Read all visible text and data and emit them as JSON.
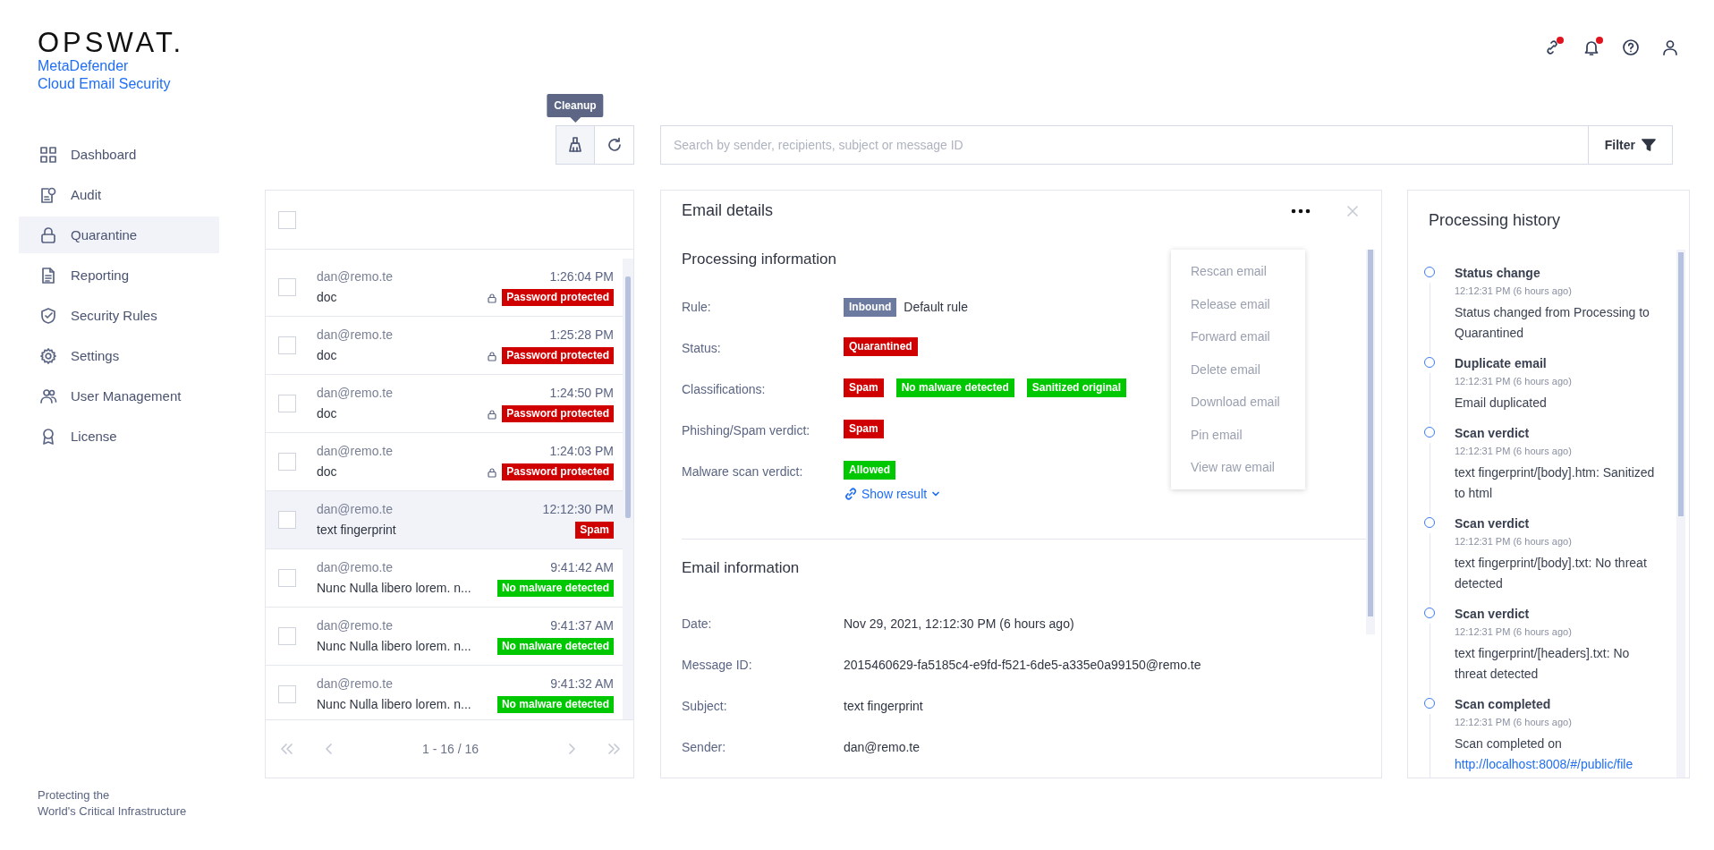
{
  "brand": {
    "logo": "OPSWAT.",
    "product": [
      "MetaDefender",
      "Cloud Email Security"
    ],
    "tagline": [
      "Protecting the",
      "World's Critical Infrastructure"
    ]
  },
  "header_icons": [
    {
      "alert": true
    },
    {
      "alert": true
    },
    {
      "alert": false
    },
    {
      "alert": false
    }
  ],
  "nav": [
    {
      "label": "Dashboard",
      "selected": false
    },
    {
      "label": "Audit",
      "selected": false
    },
    {
      "label": "Quarantine",
      "selected": true
    },
    {
      "label": "Reporting",
      "selected": false
    },
    {
      "label": "Security Rules",
      "selected": false
    },
    {
      "label": "Settings",
      "selected": false
    },
    {
      "label": "User Management",
      "selected": false
    },
    {
      "label": "License",
      "selected": false
    }
  ],
  "toolbar": {
    "tooltip": "Cleanup",
    "search": {
      "placeholder": "Search by sender, recipients, subject or message ID"
    },
    "filter": "Filter"
  },
  "email_list": {
    "select_all": {
      "checked": false
    },
    "rows": [
      {
        "sender": "dan@remo.te",
        "time": "1:26:04 PM",
        "subject": "doc",
        "locked": true,
        "tag": {
          "text": "Password protected",
          "color": "#d10000"
        },
        "selected": false,
        "checked": false
      },
      {
        "sender": "dan@remo.te",
        "time": "1:25:28 PM",
        "subject": "doc",
        "locked": true,
        "tag": {
          "text": "Password protected",
          "color": "#d10000"
        },
        "selected": false,
        "checked": false
      },
      {
        "sender": "dan@remo.te",
        "time": "1:24:50 PM",
        "subject": "doc",
        "locked": true,
        "tag": {
          "text": "Password protected",
          "color": "#d10000"
        },
        "selected": false,
        "checked": false
      },
      {
        "sender": "dan@remo.te",
        "time": "1:24:03 PM",
        "subject": "doc",
        "locked": true,
        "tag": {
          "text": "Password protected",
          "color": "#d10000"
        },
        "selected": false,
        "checked": false
      },
      {
        "sender": "dan@remo.te",
        "time": "12:12:30 PM",
        "subject": "text fingerprint",
        "locked": false,
        "tag": {
          "text": "Spam",
          "color": "#d10000"
        },
        "selected": true,
        "checked": false
      },
      {
        "sender": "dan@remo.te",
        "time": "9:41:42 AM",
        "subject": "Nunc Nulla libero lorem. n...",
        "locked": false,
        "tag": {
          "text": "No malware detected",
          "color": "#00c800"
        },
        "selected": false,
        "checked": false
      },
      {
        "sender": "dan@remo.te",
        "time": "9:41:37 AM",
        "subject": "Nunc Nulla libero lorem. n...",
        "locked": false,
        "tag": {
          "text": "No malware detected",
          "color": "#00c800"
        },
        "selected": false,
        "checked": false
      },
      {
        "sender": "dan@remo.te",
        "time": "9:41:32 AM",
        "subject": "Nunc Nulla libero lorem. n...",
        "locked": false,
        "tag": {
          "text": "No malware detected",
          "color": "#00c800"
        },
        "selected": false,
        "checked": false
      }
    ],
    "pagination": "1 - 16 / 16"
  },
  "details": {
    "title": "Email details",
    "menu": [
      "Rescan email",
      "Release email",
      "Forward email",
      "Delete email",
      "Download email",
      "Pin email",
      "View raw email"
    ],
    "sections": [
      {
        "title": "Processing information",
        "rows": [
          {
            "label": "Rule:",
            "values": [
              {
                "kind": "tag",
                "text": "Inbound",
                "color": "#6b7a9e"
              },
              {
                "kind": "text",
                "text": "Default rule"
              }
            ]
          },
          {
            "label": "Status:",
            "values": [
              {
                "kind": "tag",
                "text": "Quarantined",
                "color": "#d10000"
              }
            ]
          },
          {
            "label": "Classifications:",
            "values": [
              {
                "kind": "tag",
                "text": "Spam",
                "color": "#d10000"
              },
              {
                "kind": "tag",
                "text": "No malware detected",
                "color": "#00c800"
              },
              {
                "kind": "tag",
                "text": "Sanitized original",
                "color": "#00c800"
              }
            ]
          },
          {
            "label": "Phishing/Spam verdict:",
            "values": [
              {
                "kind": "tag",
                "text": "Spam",
                "color": "#d10000"
              }
            ]
          },
          {
            "label": "Malware scan verdict:",
            "values": [
              {
                "kind": "tag",
                "text": "Allowed",
                "color": "#00c800"
              }
            ],
            "link": "Show result"
          }
        ]
      },
      {
        "title": "Email information",
        "rows": [
          {
            "label": "Date:",
            "values": [
              {
                "kind": "text",
                "text": "Nov 29, 2021, 12:12:30 PM (6 hours ago)"
              }
            ]
          },
          {
            "label": "Message ID:",
            "values": [
              {
                "kind": "text",
                "text": "2015460629-fa5185c4-e9fd-f521-6de5-a335e0a99150@remo.te"
              }
            ]
          },
          {
            "label": "Subject:",
            "values": [
              {
                "kind": "text",
                "text": "text fingerprint"
              }
            ]
          },
          {
            "label": "Sender:",
            "values": [
              {
                "kind": "text",
                "text": "dan@remo.te"
              }
            ]
          }
        ]
      }
    ]
  },
  "history": {
    "title": "Processing history",
    "items": [
      {
        "title": "Status change",
        "time": "12:12:31 PM (6 hours ago)",
        "text": "Status changed from Processing to Quarantined"
      },
      {
        "title": "Duplicate email",
        "time": "12:12:31 PM (6 hours ago)",
        "text": "Email duplicated"
      },
      {
        "title": "Scan verdict",
        "time": "12:12:31 PM (6 hours ago)",
        "text": "text fingerprint/[body].htm: Sanitized to html"
      },
      {
        "title": "Scan verdict",
        "time": "12:12:31 PM (6 hours ago)",
        "text": "text fingerprint/[body].txt: No threat detected"
      },
      {
        "title": "Scan verdict",
        "time": "12:12:31 PM (6 hours ago)",
        "text": "text fingerprint/[headers].txt: No threat detected"
      },
      {
        "title": "Scan completed",
        "time": "12:12:31 PM (6 hours ago)",
        "text": "Scan completed on",
        "link": "http://localhost:8008/#/public/file"
      }
    ]
  }
}
